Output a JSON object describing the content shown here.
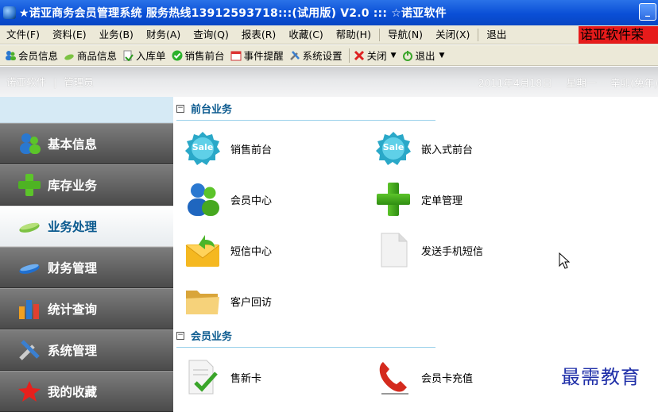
{
  "window": {
    "title": "★诺亚商务会员管理系统 服务热线13912593718:::(试用版) V2.0  :::  ☆诺亚软件",
    "minimize_symbol": "_"
  },
  "menu": {
    "items": [
      "文件(F)",
      "资料(E)",
      "业务(B)",
      "财务(A)",
      "查询(Q)",
      "报表(R)",
      "收藏(C)",
      "帮助(H)",
      "导航(N)",
      "关闭(X)",
      "退出"
    ],
    "brand_label": "诺亚软件荣"
  },
  "toolbar": {
    "items": [
      {
        "label": "会员信息",
        "icon": "members-icon"
      },
      {
        "label": "商品信息",
        "icon": "goods-icon"
      },
      {
        "label": "入库单",
        "icon": "stock-in-icon"
      },
      {
        "label": "销售前台",
        "icon": "check-icon"
      },
      {
        "label": "事件提醒",
        "icon": "calendar-icon"
      },
      {
        "label": "系统设置",
        "icon": "tools-icon"
      },
      {
        "label": "关闭",
        "icon": "close-icon"
      },
      {
        "label": "退出",
        "icon": "power-icon"
      }
    ]
  },
  "header": {
    "company": "诺亚软件",
    "divider": "|",
    "user": "管理员",
    "date": "2011年4月18日",
    "weekday": "星期一",
    "lunar": "辛卯(兔年)"
  },
  "sidebar": {
    "items": [
      {
        "label": "基本信息",
        "active": false
      },
      {
        "label": "库存业务",
        "active": false
      },
      {
        "label": "业务处理",
        "active": true
      },
      {
        "label": "财务管理",
        "active": false
      },
      {
        "label": "统计查询",
        "active": false
      },
      {
        "label": "系统管理",
        "active": false
      },
      {
        "label": "我的收藏",
        "active": false
      }
    ]
  },
  "main": {
    "sections": [
      {
        "title": "前台业务",
        "collapse_symbol": "−",
        "items": [
          {
            "label": "销售前台",
            "icon": "sale-badge-icon"
          },
          {
            "label": "嵌入式前台",
            "icon": "sale-badge-icon"
          },
          {
            "label": "会员中心",
            "icon": "members-icon"
          },
          {
            "label": "定单管理",
            "icon": "plus-icon"
          },
          {
            "label": "短信中心",
            "icon": "envelope-icon"
          },
          {
            "label": "发送手机短信",
            "icon": "document-icon"
          },
          {
            "label": "客户回访",
            "icon": "folder-icon"
          }
        ]
      },
      {
        "title": "会员业务",
        "collapse_symbol": "−",
        "items": [
          {
            "label": "售新卡",
            "icon": "card-check-icon"
          },
          {
            "label": "会员卡充值",
            "icon": "phone-icon"
          }
        ]
      }
    ],
    "sale_badge_text": "Sale"
  },
  "watermark": "最需教育",
  "colors": {
    "titlebar": "#0a4fd6",
    "section_title": "#0b5a8f",
    "sidebar_dark": "#4b4b4b",
    "brand_red": "#e61b1b",
    "watermark": "#1f2fa8"
  }
}
